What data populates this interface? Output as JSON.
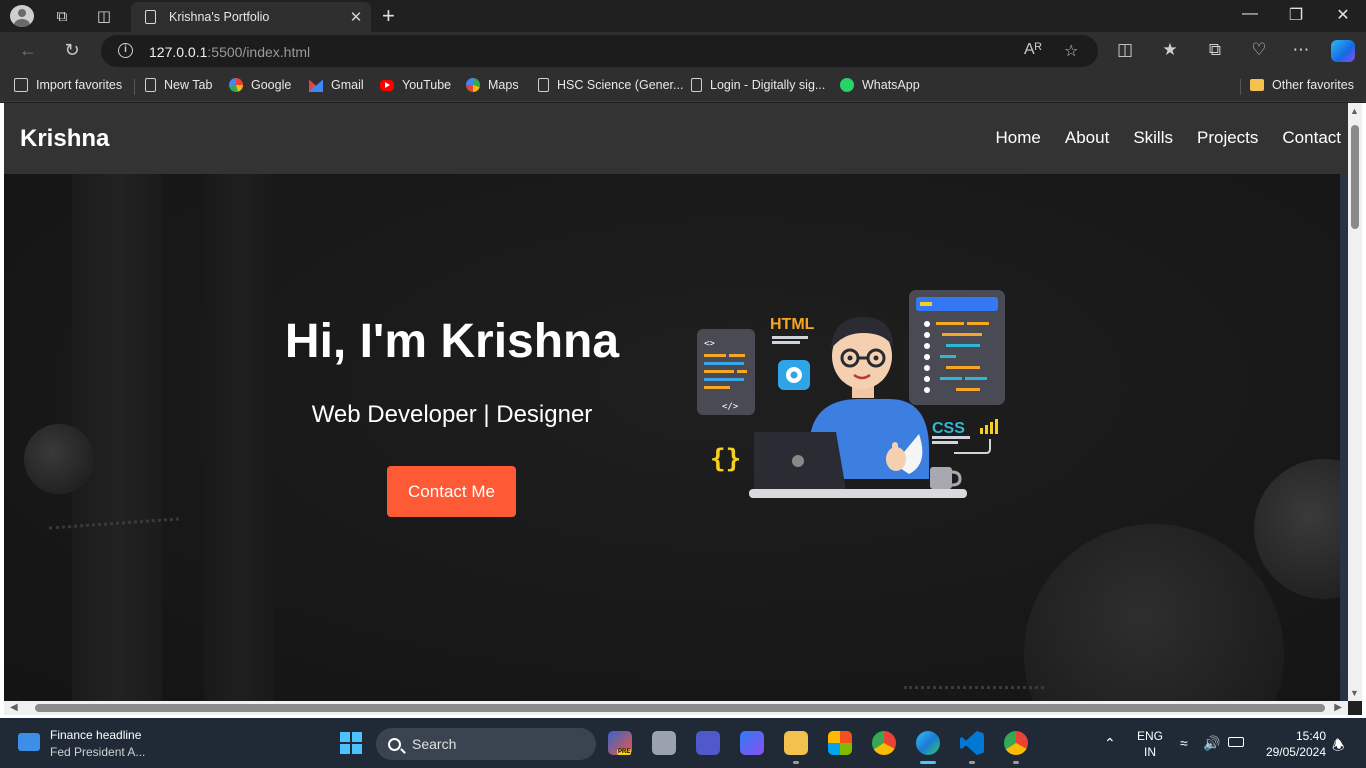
{
  "browser": {
    "tab_title": "Krishna's Portfolio",
    "url_host": "127.0.0.1",
    "url_path": ":5500/index.html",
    "favorites": [
      {
        "label": "Import favorites",
        "icon": "import-favorites-icon"
      },
      {
        "label": "New Tab",
        "icon": "page-icon"
      },
      {
        "label": "Google",
        "icon": "google-icon"
      },
      {
        "label": "Gmail",
        "icon": "gmail-icon"
      },
      {
        "label": "YouTube",
        "icon": "youtube-icon"
      },
      {
        "label": "Maps",
        "icon": "maps-icon"
      },
      {
        "label": "HSC Science (Gener...",
        "icon": "page-icon"
      },
      {
        "label": "Login - Digitally sig...",
        "icon": "page-icon"
      },
      {
        "label": "WhatsApp",
        "icon": "whatsapp-icon"
      }
    ],
    "other_favorites": "Other favorites"
  },
  "site": {
    "logo": "Krishna",
    "nav": [
      "Home",
      "About",
      "Skills",
      "Projects",
      "Contact"
    ],
    "hero": {
      "title": "Hi, I'm Krishna",
      "subtitle": "Web Developer | Designer",
      "cta": "Contact Me"
    },
    "illustration": {
      "html_label": "HTML",
      "css_label": "CSS",
      "code_tag": "<>",
      "close_tag": "</>",
      "braces": "{}"
    }
  },
  "taskbar": {
    "news_title": "Finance headline",
    "news_sub": "Fed President A...",
    "search_placeholder": "Search",
    "lang_top": "ENG",
    "lang_bottom": "IN",
    "time": "15:40",
    "date": "29/05/2024",
    "preview_badge": "PRE"
  },
  "colors": {
    "accent": "#ff5a36",
    "header_bg": "#333333",
    "hero_bg": "#1c1c1c",
    "taskbar_bg": "#1f2a36"
  }
}
